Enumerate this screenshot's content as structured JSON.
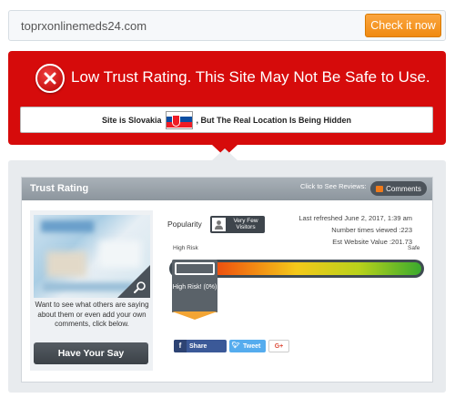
{
  "search": {
    "value": "toprxonlinemeds24.com",
    "button_label": "Check it now"
  },
  "alert": {
    "title": "Low Trust Rating. This Site May Not Be Safe to Use.",
    "location_prefix": "Site is Slovakia",
    "location_suffix": ", But The Real Location Is Being Hidden",
    "flag_icon": "slovakia-flag-icon",
    "color": "#d60b0b"
  },
  "trust_panel": {
    "title": "Trust Rating",
    "reviews_hint": "Click to See Reviews:",
    "comments_label": "Comments",
    "thumbnail_caption": "Want to see what others are saying about them or even add your own comments, click below.",
    "have_say_label": "Have Your Say",
    "popularity_label": "Popularity",
    "visitors_badge": "Very Few Visitors",
    "last_refreshed": "Last refreshed June 2, 2017, 1:39 am",
    "times_viewed": "Number times viewed :223",
    "website_value": "Est Website Value :201.73",
    "high_risk_label": "High Risk",
    "safe_label": "Safe",
    "indicator_label": "High Risk! (0%)",
    "trust_score_percent": 0
  },
  "share": {
    "facebook_label": "Share",
    "twitter_label": "Tweet",
    "google_label": "G+"
  }
}
